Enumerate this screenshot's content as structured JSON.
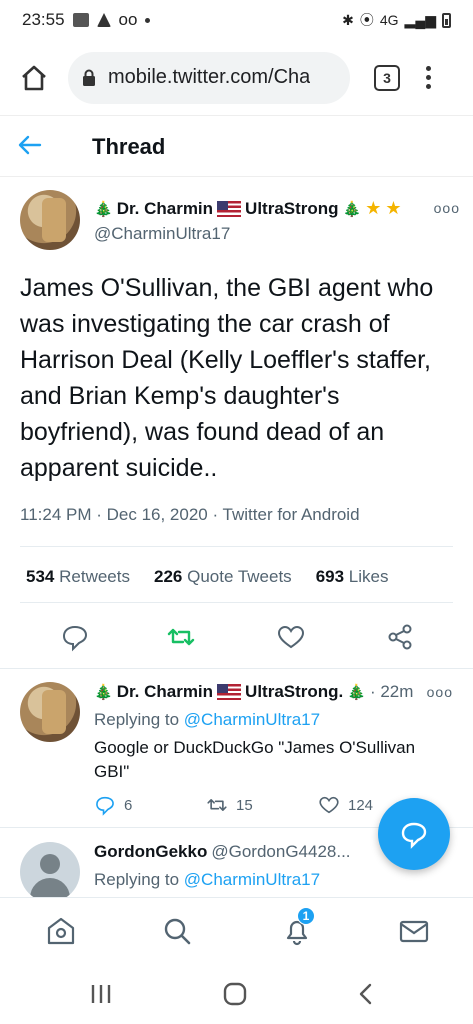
{
  "status_bar": {
    "time": "23:55",
    "notif_text": "oo",
    "network": "4G"
  },
  "browser": {
    "url": "mobile.twitter.com/Cha",
    "tab_count": "3"
  },
  "header": {
    "title": "Thread"
  },
  "main_tweet": {
    "author_name": "Dr. Charmin",
    "author_name_suffix": "UltraStrong",
    "handle": "@CharminUltra17",
    "text": "James O'Sullivan, the GBI agent who was investigating the car crash of Harrison Deal (Kelly Loeffler's staffer, and Brian Kemp's daughter's boyfriend), was found dead of an apparent suicide..",
    "timestamp": "11:24 PM · Dec 16, 2020 · Twitter for Android",
    "retweets": "534",
    "retweets_label": "Retweets",
    "quotes": "226",
    "quotes_label": "Quote Tweets",
    "likes": "693",
    "likes_label": "Likes"
  },
  "replies": [
    {
      "author_name": "Dr. Charmin",
      "author_name_suffix": "UltraStrong.",
      "time": "· 22m",
      "replying_to_label": "Replying to",
      "replying_to": "@CharminUltra17",
      "text": "Google or DuckDuckGo \"James O'Sullivan GBI\"",
      "reply_count": "6",
      "retweet_count": "15",
      "like_count": "124"
    },
    {
      "author_name": "GordonGekko",
      "handle": "@GordonG4428...",
      "replying_to_label": "Replying to",
      "replying_to": "@CharminUltra17"
    }
  ],
  "bottom_nav": {
    "notification_badge": "1"
  },
  "colors": {
    "accent": "#1da1f2",
    "retweet_green": "#17bf63",
    "text": "#0f1419",
    "secondary": "#536471"
  }
}
